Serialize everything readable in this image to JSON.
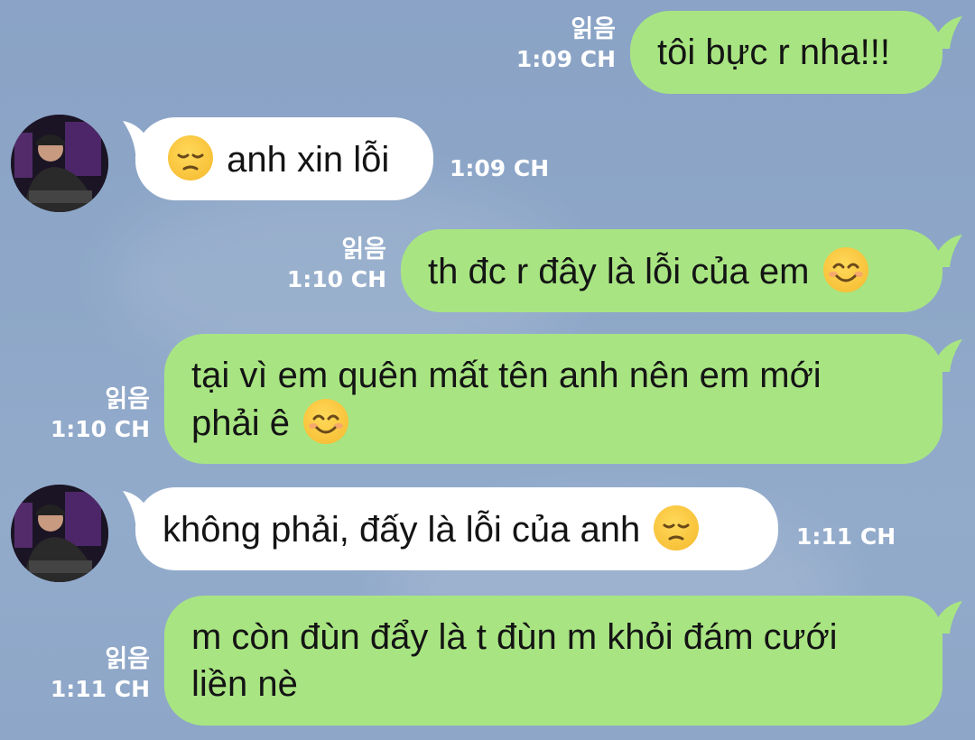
{
  "messages": [
    {
      "side": "out",
      "read": "읽음",
      "time": "1:09 CH",
      "text": "tôi bực r nha!!!"
    },
    {
      "side": "in",
      "time": "1:09 CH",
      "text": "anh xin lỗi",
      "emoji": "pensive-face"
    },
    {
      "side": "out",
      "read": "읽음",
      "time": "1:10 CH",
      "text": "th đc r đây là lỗi của em",
      "emoji": "smiling-face"
    },
    {
      "side": "out",
      "read": "읽음",
      "time": "1:10 CH",
      "line1": "tại vì em quên mất tên anh nên em mới",
      "line2": "phải ê",
      "emoji": "smiling-face"
    },
    {
      "side": "in",
      "time": "1:11 CH",
      "text": "không phải, đấy là lỗi của anh",
      "emoji": "pensive-face"
    },
    {
      "side": "out",
      "read": "읽음",
      "time": "1:11 CH",
      "line1": "m còn đùn đẩy là t đùn m khỏi đám cưới",
      "line2": "liền nè"
    }
  ],
  "colors": {
    "outgoing_bubble": "#a8e582",
    "incoming_bubble": "#ffffff",
    "background": "#8ea6c7",
    "meta_text": "#ffffff"
  }
}
